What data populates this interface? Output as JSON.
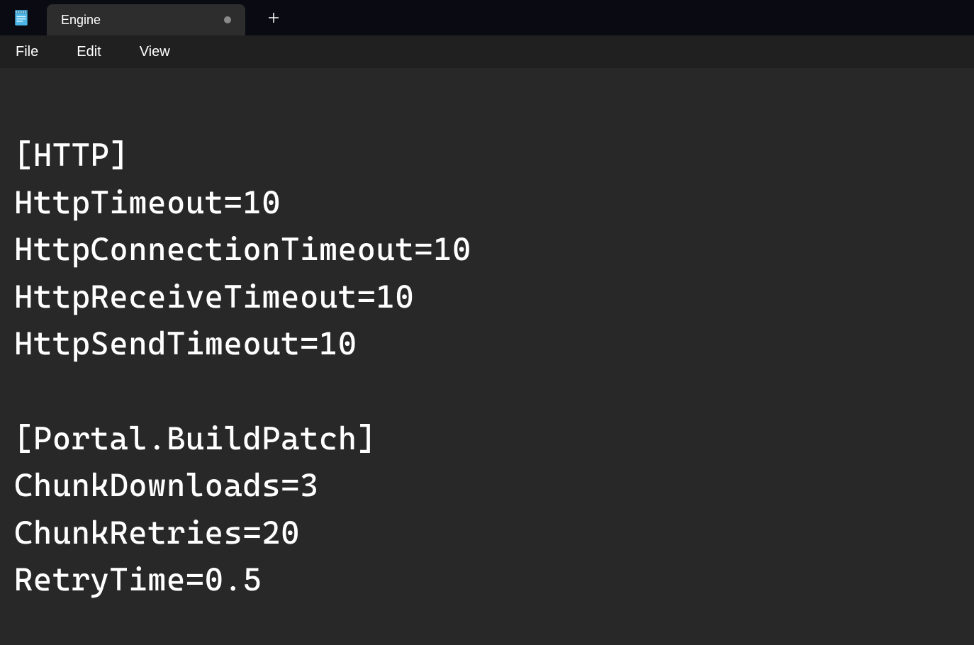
{
  "titlebar": {
    "tab_title": "Engine"
  },
  "menubar": {
    "file": "File",
    "edit": "Edit",
    "view": "View"
  },
  "editor": {
    "content": "[HTTP]\nHttpTimeout=10\nHttpConnectionTimeout=10\nHttpReceiveTimeout=10\nHttpSendTimeout=10\n\n[Portal.BuildPatch]\nChunkDownloads=3\nChunkRetries=20\nRetryTime=0.5"
  }
}
